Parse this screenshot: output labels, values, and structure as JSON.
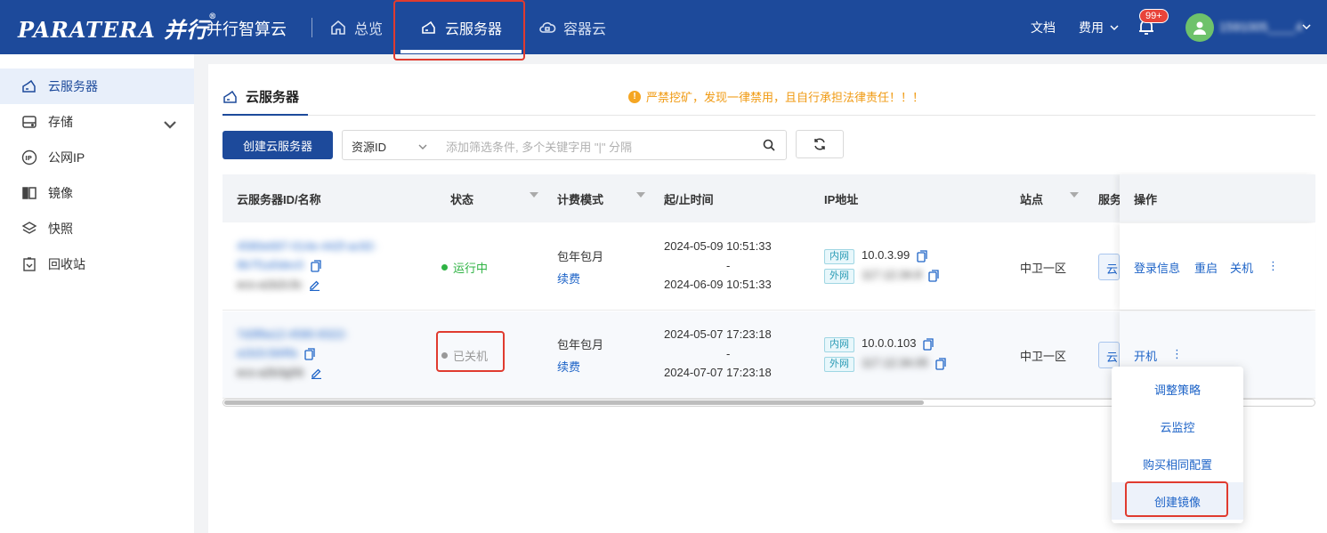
{
  "header": {
    "logo_text": "PARATERA 并行",
    "brand": "并行智算云",
    "nav": [
      {
        "label": "总览",
        "icon": "home-icon"
      },
      {
        "label": "云服务器",
        "icon": "cloud-server-icon",
        "active": true
      },
      {
        "label": "容器云",
        "icon": "container-cloud-icon"
      }
    ],
    "docs": "文档",
    "billing": "费用",
    "notification_badge": "99+",
    "username": "1591005____4"
  },
  "sidebar": {
    "items": [
      {
        "label": "云服务器",
        "icon": "cloud-server-icon",
        "active": true
      },
      {
        "label": "存储",
        "icon": "storage-icon",
        "expandable": true
      },
      {
        "label": "公网IP",
        "icon": "ip-icon"
      },
      {
        "label": "镜像",
        "icon": "image-icon"
      },
      {
        "label": "快照",
        "icon": "snapshot-icon"
      },
      {
        "label": "回收站",
        "icon": "recycle-bin-icon"
      }
    ]
  },
  "main": {
    "tab": "云服务器",
    "warning": "严禁挖矿，发现一律禁用，且自行承担法律责任！！！",
    "create_button": "创建云服务器",
    "search": {
      "field": "资源ID",
      "placeholder": "添加筛选条件, 多个关键字用 \"|\" 分隔"
    },
    "table": {
      "headers": [
        "云服务器ID/名称",
        "状态",
        "计费模式",
        "起/止时间",
        "IP地址",
        "站点",
        "服务",
        "操作"
      ],
      "rows": [
        {
          "id_line1": "4580e697-014e-442f-ac92-",
          "id_line2": "8b7f1a5dec0",
          "name": "ecs-a1b2c3c",
          "status": "运行中",
          "status_color": "#2fb344",
          "billing": "包年包月",
          "renew": "续费",
          "start": "2024-05-09 10:51:33",
          "sep": "-",
          "end": "2024-06-09 10:51:33",
          "ip_inner_tag": "内网",
          "ip_inner": "10.0.3.99",
          "ip_outer_tag": "外网",
          "ip_outer": "117.12.34.8",
          "site": "中卫一区",
          "service": "云",
          "actions": [
            "登录信息",
            "重启",
            "关机",
            "⋮"
          ]
        },
        {
          "id_line1": "7d3f9a12-4580-8322-",
          "id_line2": "a1b2c3d4fa",
          "name": "ecs-a2b3g56",
          "status": "已关机",
          "status_color": "#999999",
          "billing": "包年包月",
          "renew": "续费",
          "start": "2024-05-07 17:23:18",
          "sep": "-",
          "end": "2024-07-07 17:23:18",
          "ip_inner_tag": "内网",
          "ip_inner": "10.0.0.103",
          "ip_outer_tag": "外网",
          "ip_outer": "117.12.34.05",
          "site": "中卫一区",
          "service": "云",
          "actions": [
            "开机",
            "⋮"
          ]
        }
      ]
    },
    "dropdown": [
      "调整策略",
      "云监控",
      "购买相同配置",
      "创建镜像"
    ]
  },
  "colors": {
    "header_bg": "#1d4a9b",
    "link": "#1d63c7",
    "highlight_box": "#e03b2f",
    "warning": "#f09a12"
  }
}
